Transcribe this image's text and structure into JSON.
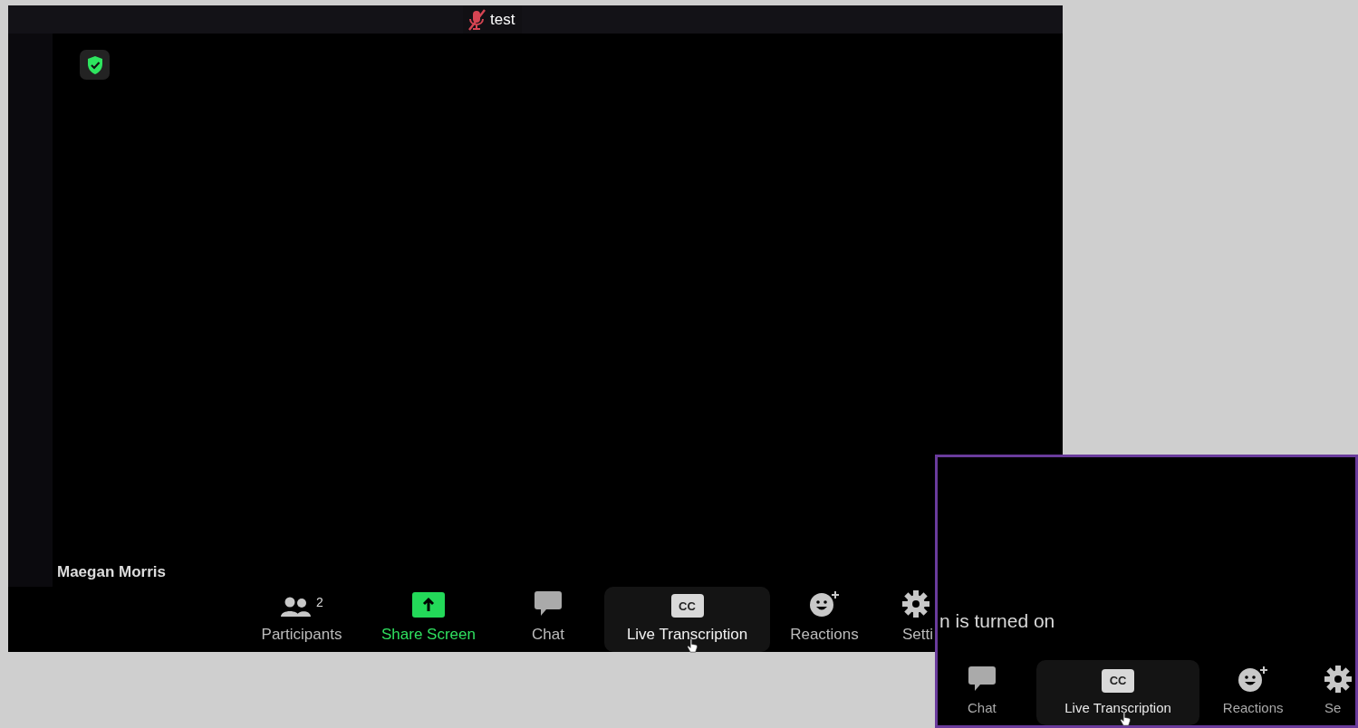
{
  "meeting": {
    "title": "test",
    "mic_muted": true,
    "participant_name": "Maegan Morris",
    "toolbar": [
      {
        "kind": "participants",
        "label": "Participants",
        "count": "2",
        "selected": false
      },
      {
        "kind": "share",
        "label": "Share Screen",
        "selected": false
      },
      {
        "kind": "chat",
        "label": "Chat",
        "selected": false
      },
      {
        "kind": "cc",
        "label": "Live Transcription",
        "icon_text": "CC",
        "selected": true
      },
      {
        "kind": "reactions",
        "label": "Reactions",
        "selected": false
      },
      {
        "kind": "settings",
        "label": "Setti",
        "selected": false
      }
    ]
  },
  "inset": {
    "notice": "n is turned on",
    "toolbar": [
      {
        "kind": "chat",
        "label": "Chat",
        "selected": false
      },
      {
        "kind": "cc",
        "label": "Live Transcription",
        "icon_text": "CC",
        "selected": true
      },
      {
        "kind": "reactions",
        "label": "Reactions",
        "selected": false
      },
      {
        "kind": "settings",
        "label": "Se",
        "selected": false
      }
    ]
  }
}
